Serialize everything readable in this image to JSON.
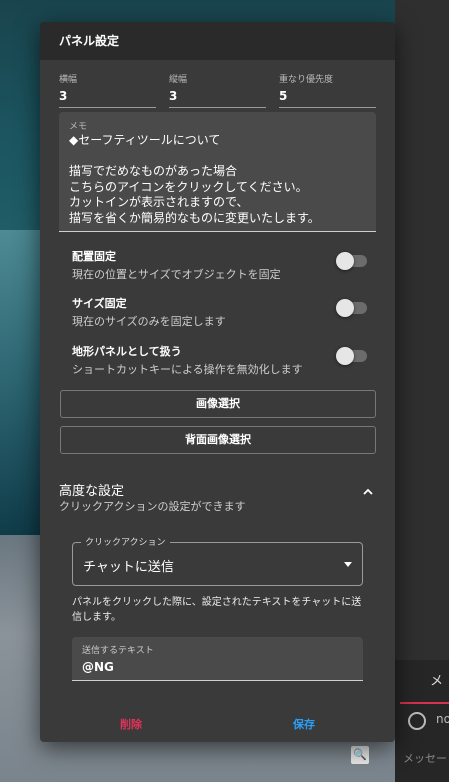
{
  "dialog": {
    "title": "パネル設定",
    "fields": [
      {
        "label": "横幅",
        "value": "3"
      },
      {
        "label": "縦幅",
        "value": "3"
      },
      {
        "label": "重なり優先度",
        "value": "5"
      }
    ],
    "memo": {
      "label": "メモ",
      "text": "◆セーフティツールについて\n\n描写でだめなものがあった場合\nこちらのアイコンをクリックしてください。\nカットインが表示されますので、\n描写を省くか簡易的なものに変更いたします。"
    },
    "toggles": [
      {
        "title": "配置固定",
        "desc": "現在の位置とサイズでオブジェクトを固定",
        "on": false
      },
      {
        "title": "サイズ固定",
        "desc": "現在のサイズのみを固定します",
        "on": false
      },
      {
        "title": "地形パネルとして扱う",
        "desc": "ショートカットキーによる操作を無効化します",
        "on": false
      }
    ],
    "image_button": "画像選択",
    "back_image_button": "背面画像選択",
    "advanced": {
      "title": "高度な設定",
      "subtitle": "クリックアクションの設定ができます",
      "click_action_label": "クリックアクション",
      "click_action_value": "チャットに送信",
      "help": "パネルをクリックした際に、設定されたテキストをチャットに送信します。",
      "send_text_label": "送信するテキスト",
      "send_text_value": "@NG"
    },
    "delete_label": "削除",
    "save_label": "保存"
  },
  "background": {
    "tab_label": "メ",
    "user_label": "no",
    "message_placeholder": "メッセー"
  },
  "colors": {
    "delete": "#e0335a",
    "save": "#2a9df4",
    "accent": "#d6314d"
  }
}
